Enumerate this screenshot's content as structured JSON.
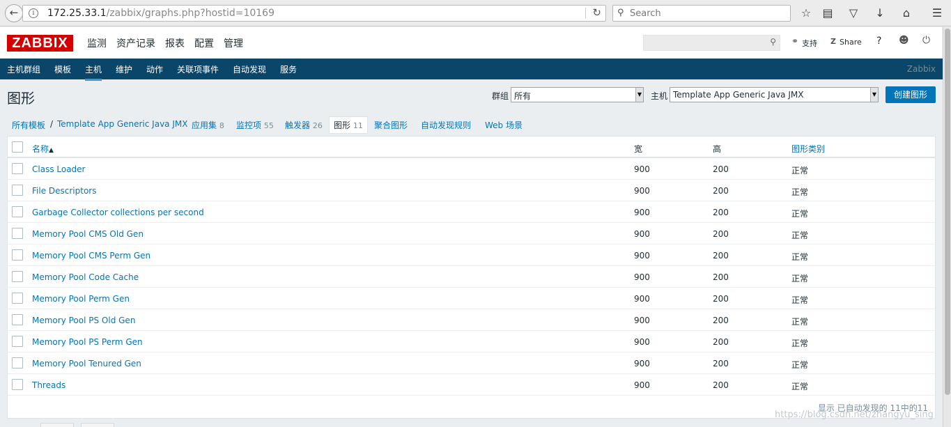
{
  "browser": {
    "url_host": "172.25.33.1",
    "url_path": "/zabbix/graphs.php?hostid=10169",
    "search_placeholder": "Search"
  },
  "header": {
    "logo": "ZABBIX",
    "menu": [
      "监测",
      "资产记录",
      "报表",
      "配置",
      "管理"
    ],
    "support": "支持",
    "share": "Share",
    "help": "?"
  },
  "subnav": {
    "items": [
      "主机群组",
      "模板",
      "主机",
      "维护",
      "动作",
      "关联项事件",
      "自动发现",
      "服务"
    ],
    "brand": "Zabbix"
  },
  "page": {
    "title": "图形",
    "group_label": "群组",
    "group_value": "所有",
    "host_label": "主机",
    "host_value": "Template App Generic Java JMX",
    "create_button": "创建图形"
  },
  "tabs": {
    "all_templates": "所有模板",
    "separator": "/",
    "template": "Template App Generic Java JMX",
    "apps": "应用集",
    "apps_count": "8",
    "items": "监控项",
    "items_count": "55",
    "triggers": "触发器",
    "triggers_count": "26",
    "graphs": "图形",
    "graphs_count": "11",
    "screens": "聚合图形",
    "discovery": "自动发现规则",
    "web": "Web 场景"
  },
  "table": {
    "headers": {
      "name": "名称",
      "width": "宽",
      "height": "高",
      "type": "图形类别"
    },
    "sort_arrow": "▲",
    "rows": [
      {
        "name": "Class Loader",
        "width": "900",
        "height": "200",
        "type": "正常"
      },
      {
        "name": "File Descriptors",
        "width": "900",
        "height": "200",
        "type": "正常"
      },
      {
        "name": "Garbage Collector collections per second",
        "width": "900",
        "height": "200",
        "type": "正常"
      },
      {
        "name": "Memory Pool CMS Old Gen",
        "width": "900",
        "height": "200",
        "type": "正常"
      },
      {
        "name": "Memory Pool CMS Perm Gen",
        "width": "900",
        "height": "200",
        "type": "正常"
      },
      {
        "name": "Memory Pool Code Cache",
        "width": "900",
        "height": "200",
        "type": "正常"
      },
      {
        "name": "Memory Pool Perm Gen",
        "width": "900",
        "height": "200",
        "type": "正常"
      },
      {
        "name": "Memory Pool PS Old Gen",
        "width": "900",
        "height": "200",
        "type": "正常"
      },
      {
        "name": "Memory Pool PS Perm Gen",
        "width": "900",
        "height": "200",
        "type": "正常"
      },
      {
        "name": "Memory Pool Tenured Gen",
        "width": "900",
        "height": "200",
        "type": "正常"
      },
      {
        "name": "Threads",
        "width": "900",
        "height": "200",
        "type": "正常"
      }
    ],
    "footer": "显示 已自动发现的 11中的11"
  },
  "watermark": "https://blog.csdn.net/zhangyu_sing"
}
